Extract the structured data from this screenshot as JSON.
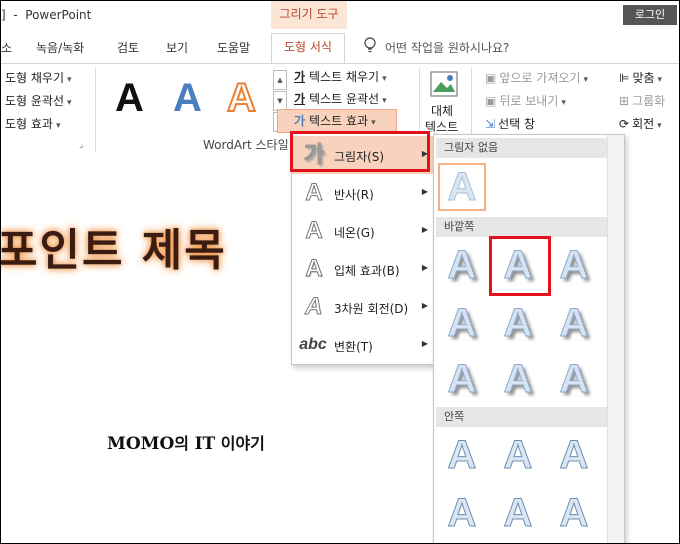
{
  "titlebar": {
    "title": "]  -  PowerPoint",
    "context_tab": "그리기 도구",
    "login": "로그인"
  },
  "tabs": {
    "items": [
      {
        "label": "소"
      },
      {
        "label": "녹음/녹화"
      },
      {
        "label": "검토"
      },
      {
        "label": "보기"
      },
      {
        "label": "도움말"
      },
      {
        "label": "도형 서식"
      }
    ],
    "tell_me": "어떤 작업을 원하시나요?"
  },
  "ribbon": {
    "shape_styles": {
      "fill": "도형 채우기",
      "outline": "도형 윤곽선",
      "effects": "도형 효과"
    },
    "wordart": {
      "letters": [
        "A",
        "A",
        "A"
      ],
      "text_fill": "텍스트 채우기",
      "text_outline": "텍스트 윤곽선",
      "text_effect": "텍스트 효과",
      "group_label": "WordArt 스타일"
    },
    "alt_text": {
      "line1": "대체",
      "line2": "텍스트"
    },
    "arrange": {
      "bring_forward": "앞으로 가져오기",
      "send_backward": "뒤로 보내기",
      "selection_pane": "선택 창",
      "align": "맞춤",
      "group": "그룹화",
      "rotate": "회전"
    }
  },
  "slide": {
    "title": "포인트 제목",
    "subtitle_part1": "MOMO",
    "subtitle_part2": "의 ",
    "subtitle_part3": "IT",
    "subtitle_part4": " 이야기"
  },
  "menu": {
    "items": [
      {
        "icon": "가",
        "label": "그림자(S)"
      },
      {
        "icon": "A",
        "label": "반사(R)"
      },
      {
        "icon": "A",
        "label": "네온(G)"
      },
      {
        "icon": "A",
        "label": "입체 효과(B)"
      },
      {
        "icon": "A",
        "label": "3차원 회전(D)"
      },
      {
        "icon": "abc",
        "label": "변환(T)"
      }
    ]
  },
  "gallery": {
    "sections": {
      "none": "그림자 없음",
      "outer": "바깥쪽",
      "inner": "안쪽"
    },
    "glyph": "A"
  },
  "colors": {
    "accent": "#b7472a",
    "highlight": "#f8d2bd",
    "annotation": "#e3121a"
  }
}
